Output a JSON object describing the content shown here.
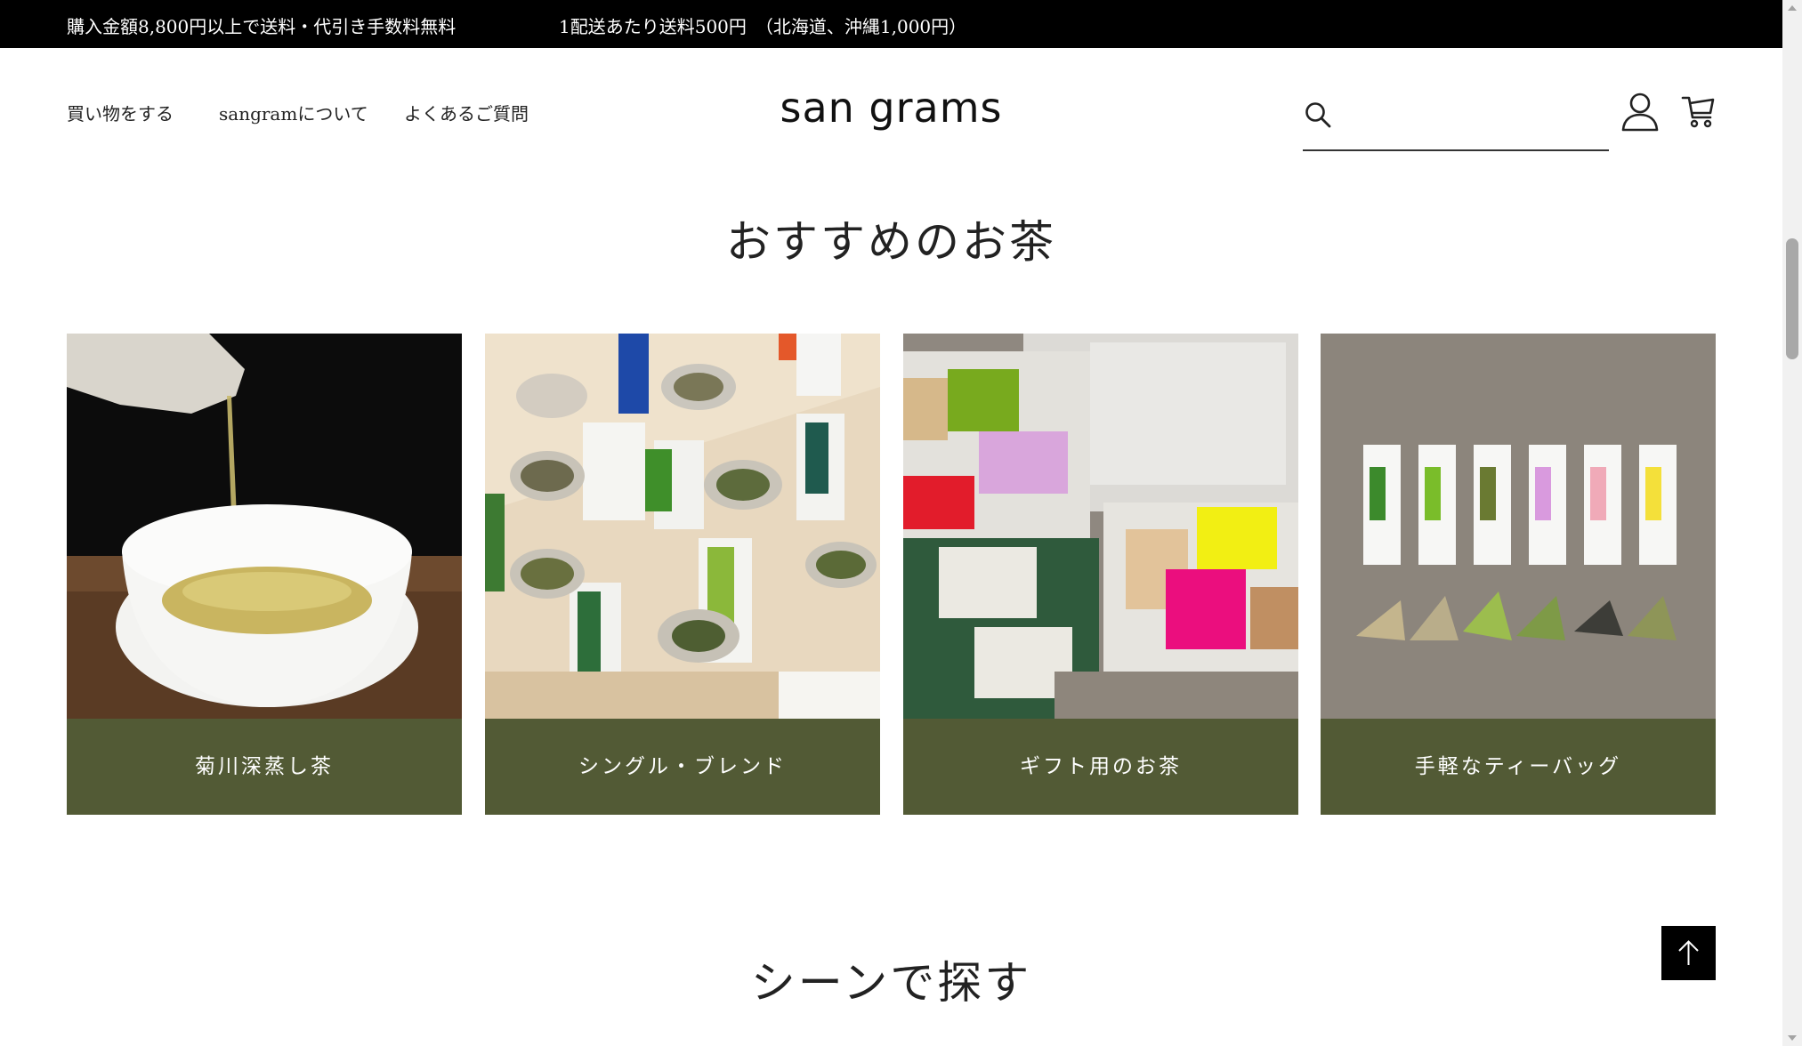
{
  "announcement": {
    "free_shipping": "購入金額8,800円以上で送料・代引き手数料無料",
    "shipping_fee": "1配送あたり送料500円　（北海道、沖縄1,000円）"
  },
  "nav": {
    "shop": "買い物をする",
    "about": "sangramについて",
    "faq": "よくあるご質問"
  },
  "logo": "san grams",
  "search": {
    "value": "",
    "placeholder": ""
  },
  "icons": [
    "search-icon",
    "account-icon",
    "cart-icon",
    "arrow-up-icon"
  ],
  "sections": {
    "recommended_title": "おすすめのお茶",
    "scene_title": "シーンで探す"
  },
  "cards": [
    {
      "label": "菊川深蒸し茶"
    },
    {
      "label": "シングル・ブレンド"
    },
    {
      "label": "ギフト用のお茶"
    },
    {
      "label": "手軽なティーバッグ"
    }
  ],
  "colors": {
    "accent_olive": "#525a35",
    "topbar": "#000000"
  }
}
